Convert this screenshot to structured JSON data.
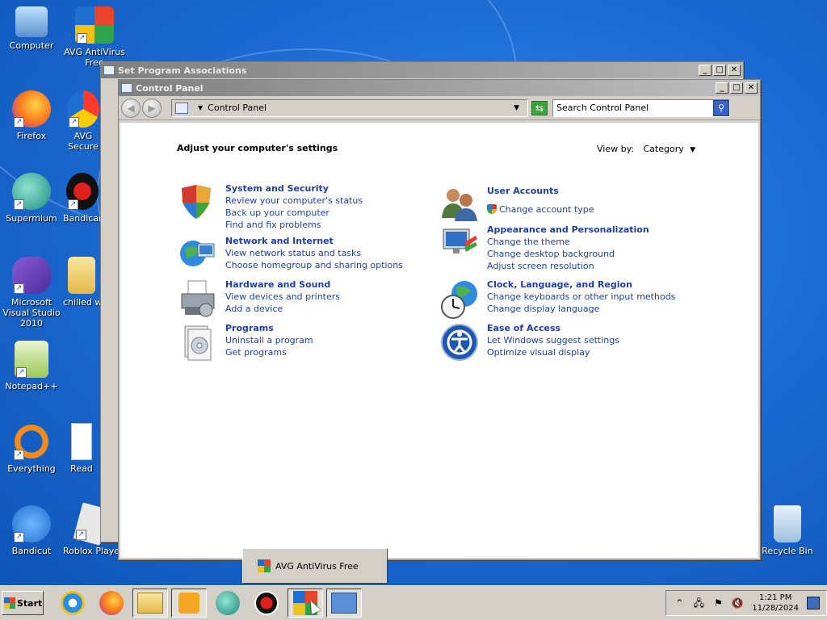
{
  "desktop": {
    "icons": [
      {
        "label": "Computer",
        "icon": "computer-icon"
      },
      {
        "label": "AVG AntiVirus Free",
        "icon": "avg-antivirus-icon"
      },
      {
        "label": "Firefox",
        "icon": "firefox-icon"
      },
      {
        "label": "AVG Secure Browser",
        "icon": "avg-browser-icon"
      },
      {
        "label": "Supermium",
        "icon": "supermium-icon"
      },
      {
        "label": "Bandicam",
        "icon": "bandicam-icon"
      },
      {
        "label": "Microsoft Visual Studio 2010",
        "icon": "visual-studio-icon"
      },
      {
        "label": "chilled wi",
        "icon": "folder-icon"
      },
      {
        "label": "Notepad++",
        "icon": "notepadpp-icon"
      },
      {
        "label": "Everything",
        "icon": "everything-icon"
      },
      {
        "label": "Read",
        "icon": "document-icon"
      },
      {
        "label": "Bandicut",
        "icon": "bandicut-icon"
      },
      {
        "label": "Roblox Player",
        "icon": "roblox-icon"
      },
      {
        "label": "Recycle Bin",
        "icon": "recycle-bin-icon"
      }
    ]
  },
  "background_window": {
    "title": "Set Program Associations"
  },
  "control_panel": {
    "title": "Control Panel",
    "address": {
      "path": "Control Panel"
    },
    "search_placeholder": "Search Control Panel",
    "heading": "Adjust your computer's settings",
    "view_by_label": "View by:",
    "view_by_value": "Category",
    "categories_left": [
      {
        "title": "System and Security",
        "icon": "shield-icon",
        "links": [
          "Review your computer's status",
          "Back up your computer",
          "Find and fix problems"
        ]
      },
      {
        "title": "Network and Internet",
        "icon": "network-icon",
        "links": [
          "View network status and tasks",
          "Choose homegroup and sharing options"
        ]
      },
      {
        "title": "Hardware and Sound",
        "icon": "printer-icon",
        "links": [
          "View devices and printers",
          "Add a device"
        ]
      },
      {
        "title": "Programs",
        "icon": "programs-icon",
        "links": [
          "Uninstall a program",
          "Get programs"
        ]
      }
    ],
    "categories_right": [
      {
        "title": "User Accounts",
        "icon": "users-icon",
        "links": [
          "Change account type"
        ]
      },
      {
        "title": "Appearance and Personalization",
        "icon": "monitor-paint-icon",
        "links": [
          "Change the theme",
          "Change desktop background",
          "Adjust screen resolution"
        ]
      },
      {
        "title": "Clock, Language, and Region",
        "icon": "clock-globe-icon",
        "links": [
          "Change keyboards or other input methods",
          "Change display language"
        ]
      },
      {
        "title": "Ease of Access",
        "icon": "ease-of-access-icon",
        "links": [
          "Let Windows suggest settings",
          "Optimize visual display"
        ]
      }
    ]
  },
  "tooltip": {
    "text": "AVG AntiVirus Free"
  },
  "taskbar": {
    "start_label": "Start",
    "items": [
      "internet-explorer-icon",
      "firefox-icon",
      "explorer-icon",
      "media-player-icon",
      "supermium-icon",
      "bandicam-icon",
      "avg-antivirus-icon",
      "control-panel-icon"
    ],
    "clock_time": "1:21 PM",
    "clock_date": "11/28/2024"
  },
  "colors": {
    "desktop": "#1a68cf",
    "link": "#1d3fa5",
    "window_chrome": "#d4d0c8"
  }
}
